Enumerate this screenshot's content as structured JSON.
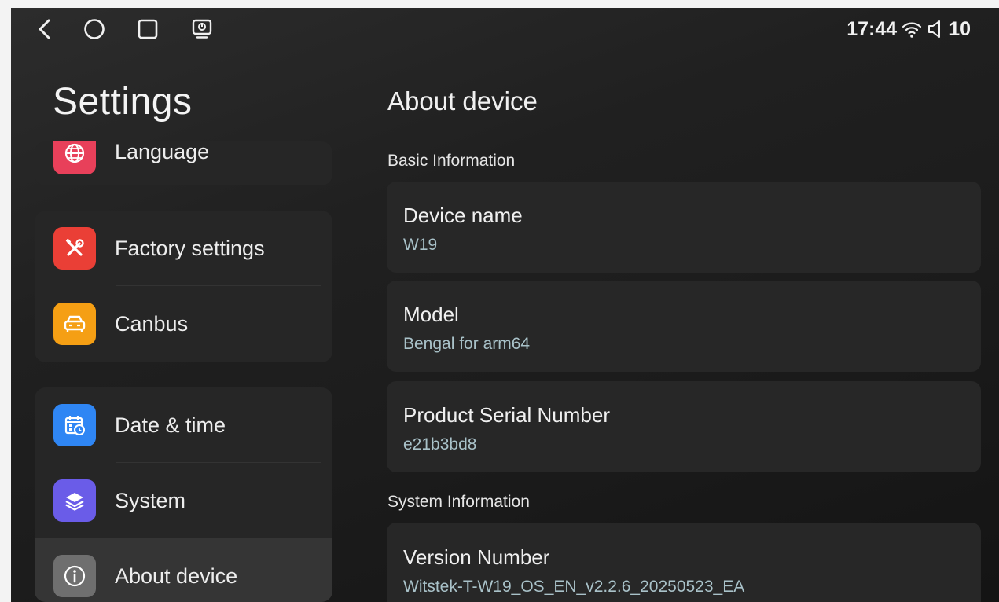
{
  "status_bar": {
    "nav_icons": [
      "back-icon",
      "home-icon",
      "recents-icon",
      "screen-cast-icon"
    ],
    "time": "17:44",
    "volume": "10"
  },
  "sidebar": {
    "title": "Settings",
    "items": [
      {
        "label": "Language",
        "icon": "globe-icon",
        "color": "#e8405a"
      },
      {
        "label": "Factory settings",
        "icon": "tools-icon",
        "color": "#ea3f36"
      },
      {
        "label": "Canbus",
        "icon": "car-icon",
        "color": "#f59f14"
      },
      {
        "label": "Date & time",
        "icon": "calendar-clock-icon",
        "color": "#2f86f4"
      },
      {
        "label": "System",
        "icon": "layers-icon",
        "color": "#6a5ce8"
      },
      {
        "label": "About device",
        "icon": "info-icon",
        "color": "#6f6f6f",
        "selected": true
      }
    ]
  },
  "main": {
    "title": "About device",
    "sections": [
      {
        "header": "Basic Information",
        "rows": [
          {
            "label": "Device name",
            "value": "W19"
          },
          {
            "label": "Model",
            "value": "Bengal for arm64"
          },
          {
            "label": "Product Serial Number",
            "value": "e21b3bd8"
          }
        ]
      },
      {
        "header": "System Information",
        "rows": [
          {
            "label": "Version Number",
            "value": "Witstek-T-W19_OS_EN_v2.2.6_20250523_EA"
          }
        ]
      }
    ]
  },
  "colors": {
    "background": "#1e1e1e",
    "card": "#272727",
    "value_text": "#a9c2c9",
    "selected_item": "#353535"
  }
}
